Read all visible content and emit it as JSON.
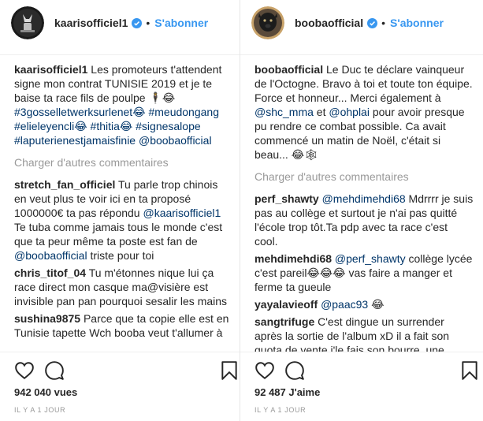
{
  "left": {
    "username": "kaarisofficiel1",
    "follow_label": "S'abonner",
    "caption_user": "kaarisofficiel1",
    "caption_text": "Les promoteurs t'attendent signe mon contrat TUNISIE 2019 et je te baise ta race fils de poulpe 🕴😂",
    "caption_tags": [
      "#3gosselletwerksurlenet😂",
      "#meudongang",
      "#elieleyencli😂",
      "#thitia😂",
      "#signesalope",
      "#laputerienestjamaisfinie",
      "@boobaofficial"
    ],
    "load_more": "Charger d'autres commentaires",
    "comments": [
      {
        "user": "stretch_fan_officiel",
        "before": "Tu parle trop chinois en veut plus te voir ici en ta proposé 1000000€ ta pas répondu",
        "mention": "@kaarisofficiel1",
        "after": "Te tuba comme jamais tous le monde c'est que ta peur même ta poste est fan de",
        "mention2": "@boobaofficial",
        "after2": "triste pour toi"
      },
      {
        "user": "chris_titof_04",
        "before": "Tu m'étonnes nique lui ça race direct mon casque ma@visière est invisible pan pan pourquoi sesalir les mains",
        "mention": "",
        "after": "",
        "mention2": "",
        "after2": ""
      },
      {
        "user": "sushina9875",
        "before": "Parce que ta copie elle est en Tunisie tapette Wch booba veut t'allumer à",
        "mention": "",
        "after": "",
        "mention2": "",
        "after2": ""
      }
    ],
    "counter": "942 040 vues",
    "time": "IL Y A 1 JOUR"
  },
  "right": {
    "username": "boobaofficial",
    "follow_label": "S'abonner",
    "caption_user": "boobaofficial",
    "caption_before": "Le Duc te déclare vainqueur de l'Octogne. Bravo à toi et toute ton équipe. Force et honneur... Merci également à",
    "caption_m1": "@shc_mma",
    "caption_mid": "et",
    "caption_m2": "@ohplai",
    "caption_after": "pour avoir presque pu rendre ce combat possible. Ca avait commencé un matin de Noël, c'était si beau... 😂🕸",
    "load_more": "Charger d'autres commentaires",
    "comments": [
      {
        "user": "perf_shawty",
        "mention": "@mehdimehdi68",
        "text": "Mdrrrr je suis pas au collège et surtout je n'ai pas quitté l'école trop tôt.Ta pdp avec ta race c'est cool."
      },
      {
        "user": "mehdimehdi68",
        "mention": "@perf_shawty",
        "text": "collège lycée c'est pareil😂😂😂 vas faire a manger et ferme ta gueule"
      },
      {
        "user": "yayalavieoff",
        "mention": "@paac93",
        "text": "😂"
      },
      {
        "user": "sangtrifuge",
        "mention": "",
        "text": "C'est dingue un surrender après la sortie de l'album xD il a fait son quota de vente j'le fais son bourre, une"
      }
    ],
    "counter": "92 487 J'aime",
    "time": "IL Y A 1 JOUR"
  },
  "colors": {
    "accent": "#3897f0",
    "link": "#003569",
    "muted": "#999999",
    "text": "#262626"
  },
  "icons": [
    "heart-icon",
    "comment-icon",
    "bookmark-icon",
    "verified-badge-icon"
  ]
}
